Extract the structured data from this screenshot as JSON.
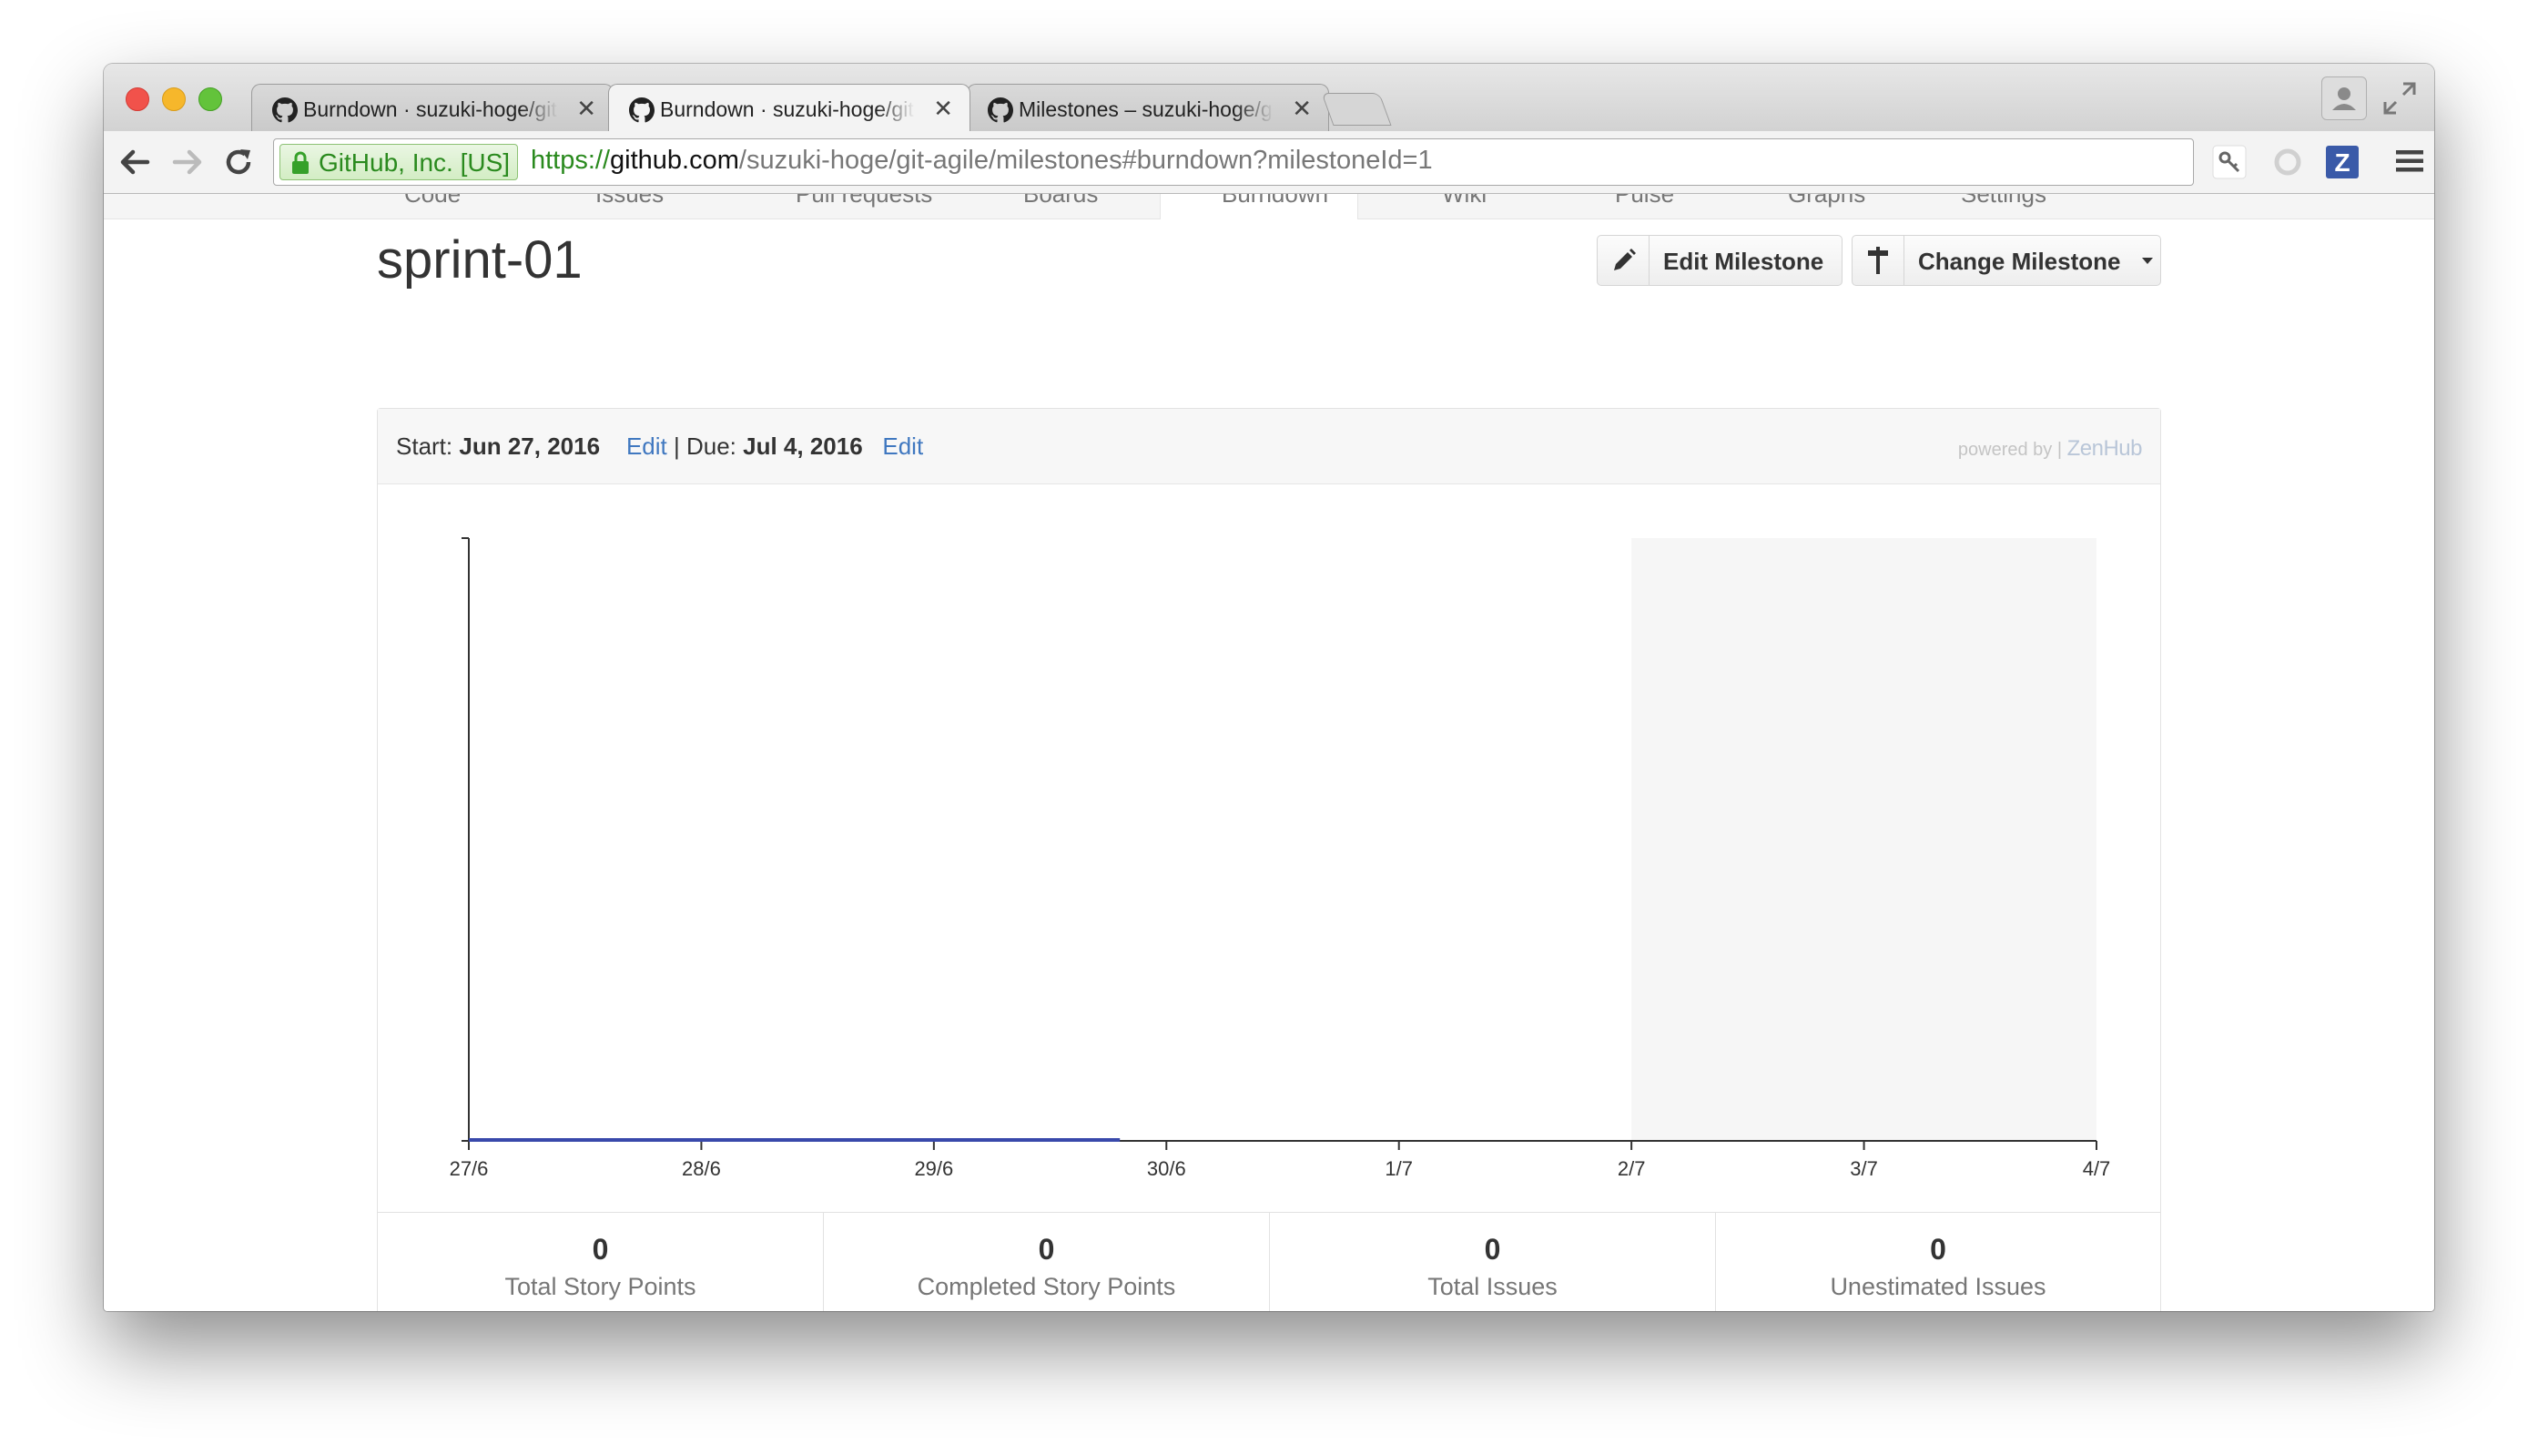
{
  "browser": {
    "tabs": [
      {
        "title": "Burndown · suzuki-hoge/git-agile",
        "active": false
      },
      {
        "title": "Burndown · suzuki-hoge/git-agile",
        "active": true
      },
      {
        "title": "Milestones – suzuki-hoge/git-agile",
        "active": false
      }
    ],
    "ev_label": "GitHub, Inc. [US]",
    "url_scheme": "https://",
    "url_host": "github.com",
    "url_path": "/suzuki-hoge/git-agile/milestones#burndown?milestoneId=1",
    "extension_letter": "Z"
  },
  "repo_nav": {
    "items": [
      "Code",
      "Issues",
      "Pull requests",
      "Boards",
      "Burndown",
      "Wiki",
      "Pulse",
      "Graphs",
      "Settings"
    ],
    "active": "Burndown"
  },
  "milestone": {
    "title": "sprint-01",
    "edit_button": "Edit Milestone",
    "change_button": "Change Milestone",
    "start_label": "Start:",
    "start_date": "Jun 27, 2016",
    "due_label": "Due:",
    "due_date": "Jul 4, 2016",
    "edit_link": "Edit",
    "separator": "|",
    "powered_by": "powered by",
    "powered_brand": "ZenHub"
  },
  "chart_data": {
    "type": "line",
    "categories": [
      "27/6",
      "28/6",
      "29/6",
      "30/6",
      "1/7",
      "2/7",
      "3/7",
      "4/7"
    ],
    "series": [
      {
        "values": [
          0,
          0,
          0,
          0
        ],
        "end_x": 2.8,
        "color": "#3949ab"
      }
    ],
    "weekend_shade": {
      "from": "2/7",
      "to": "4/7",
      "color": "#f6f6f6"
    },
    "y_axis_labels": false
  },
  "stats": [
    {
      "value": "0",
      "label": "Total Story Points"
    },
    {
      "value": "0",
      "label": "Completed Story Points"
    },
    {
      "value": "0",
      "label": "Total Issues"
    },
    {
      "value": "0",
      "label": "Unestimated Issues"
    }
  ]
}
